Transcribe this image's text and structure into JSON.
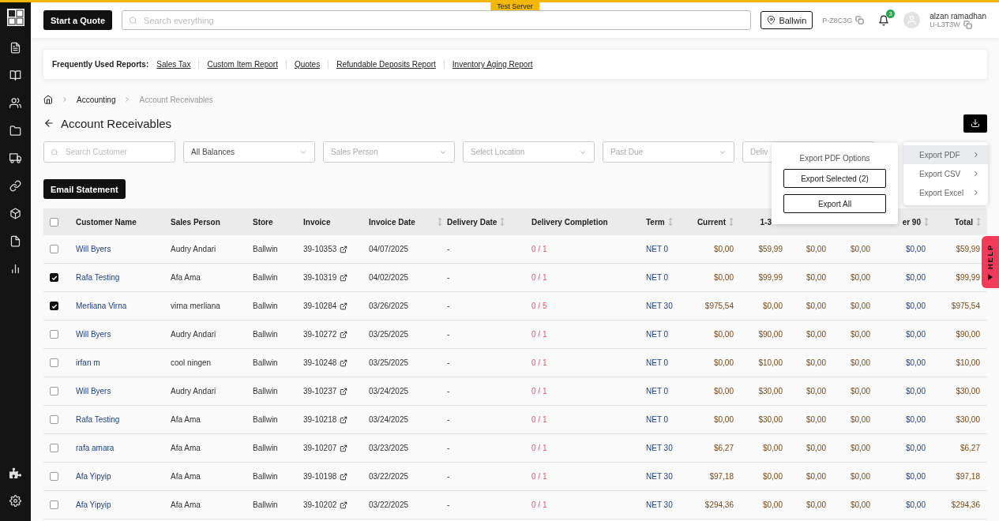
{
  "topbar": {
    "quote_button": "Start a Quote",
    "search": {
      "placeholder": "Search everything"
    },
    "server_badge": "Test Server",
    "location": "Ballwin",
    "profile_code": "P-Z8C3G",
    "notification_count": "3",
    "user": {
      "name": "alzan ramadhan",
      "code": "U-L3T3W"
    }
  },
  "reports": {
    "label": "Frequently Used Reports:",
    "links": [
      "Sales Tax",
      "Custom Item Report",
      "Quotes",
      "Refundable Deposits Report",
      "Inventory Aging Report"
    ]
  },
  "breadcrumb": [
    "Accounting",
    "Account Receivables"
  ],
  "title": "Account Receivables",
  "filters": [
    {
      "kind": "search",
      "placeholder": "Search Customer"
    },
    {
      "kind": "select",
      "value": "All Balances"
    },
    {
      "kind": "select",
      "placeholder": "Sales Person"
    },
    {
      "kind": "select",
      "placeholder": "Select Location"
    },
    {
      "kind": "select",
      "placeholder": "Past Due"
    },
    {
      "kind": "select",
      "placeholder": "Deliv"
    }
  ],
  "email_button": "Email Statement",
  "export_menu": {
    "items": [
      {
        "label": "Export PDF",
        "selected": true
      },
      {
        "label": "Export CSV",
        "selected": false
      },
      {
        "label": "Export Excel",
        "selected": false
      }
    ]
  },
  "export_popup": {
    "title": "Export PDF Options",
    "buttons": [
      "Export Selected (2)",
      "Export All"
    ]
  },
  "help_tab": "HELP",
  "table": {
    "select_all_checked": false,
    "columns": [
      {
        "label": "Customer Name",
        "sortable": false
      },
      {
        "label": "Sales Person",
        "sortable": false
      },
      {
        "label": "Store",
        "sortable": false
      },
      {
        "label": "Invoice",
        "sortable": false
      },
      {
        "label": "Invoice Date",
        "sortable": true
      },
      {
        "label": "Delivery Date",
        "sortable": true
      },
      {
        "label": "Delivery Completion",
        "sortable": false
      },
      {
        "label": "Term",
        "sortable": true
      },
      {
        "label": "Current",
        "sortable": true
      },
      {
        "label": "1-3",
        "sortable": false
      },
      {},
      {},
      {
        "label": "er 90",
        "sortable": true
      },
      {
        "label": "Total",
        "sortable": true
      }
    ],
    "rows": [
      {
        "checked": false,
        "customer": "Will Byers",
        "sales_person": "Audry Andari",
        "store": "Ballwin",
        "invoice": "39-10353",
        "invoice_date": "04/07/2025",
        "delivery_date": "-",
        "completion": "0 / 1",
        "term": "NET 0",
        "amounts": [
          "$0,00",
          "$59,99",
          "$0,00",
          "$0,00",
          "$0,00",
          "$59,99"
        ]
      },
      {
        "checked": true,
        "customer": "Rafa Testing",
        "sales_person": "Afa Ama",
        "store": "Ballwin",
        "invoice": "39-10319",
        "invoice_date": "04/02/2025",
        "delivery_date": "-",
        "completion": "0 / 1",
        "term": "NET 0",
        "amounts": [
          "$0,00",
          "$99,99",
          "$0,00",
          "$0,00",
          "$0,00",
          "$99,99"
        ]
      },
      {
        "checked": true,
        "customer": "Merliana Virna",
        "sales_person": "virna merliana",
        "store": "Ballwin",
        "invoice": "39-10284",
        "invoice_date": "03/26/2025",
        "delivery_date": "-",
        "completion": "0 / 5",
        "term": "NET 30",
        "amounts": [
          "$975,54",
          "$0,00",
          "$0,00",
          "$0,00",
          "$0,00",
          "$975,54"
        ]
      },
      {
        "checked": false,
        "customer": "Will Byers",
        "sales_person": "Audry Andari",
        "store": "Ballwin",
        "invoice": "39-10272",
        "invoice_date": "03/25/2025",
        "delivery_date": "-",
        "completion": "0 / 1",
        "term": "NET 0",
        "amounts": [
          "$0,00",
          "$90,00",
          "$0,00",
          "$0,00",
          "$0,00",
          "$90,00"
        ]
      },
      {
        "checked": false,
        "customer": "irfan m",
        "sales_person": "cool ningen",
        "store": "Ballwin",
        "invoice": "39-10248",
        "invoice_date": "03/25/2025",
        "delivery_date": "-",
        "completion": "0 / 1",
        "term": "NET 0",
        "amounts": [
          "$0,00",
          "$10,00",
          "$0,00",
          "$0,00",
          "$0,00",
          "$10,00"
        ]
      },
      {
        "checked": false,
        "customer": "Will Byers",
        "sales_person": "Audry Andari",
        "store": "Ballwin",
        "invoice": "39-10237",
        "invoice_date": "03/24/2025",
        "delivery_date": "-",
        "completion": "0 / 1",
        "term": "NET 0",
        "amounts": [
          "$0,00",
          "$30,00",
          "$0,00",
          "$0,00",
          "$0,00",
          "$30,00"
        ]
      },
      {
        "checked": false,
        "customer": "Rafa Testing",
        "sales_person": "Afa Ama",
        "store": "Ballwin",
        "invoice": "39-10218",
        "invoice_date": "03/24/2025",
        "delivery_date": "-",
        "completion": "0 / 1",
        "term": "NET 0",
        "amounts": [
          "$0,00",
          "$30,00",
          "$0,00",
          "$0,00",
          "$0,00",
          "$30,00"
        ]
      },
      {
        "checked": false,
        "customer": "rafa amara",
        "sales_person": "Afa Ama",
        "store": "Ballwin",
        "invoice": "39-10207",
        "invoice_date": "03/23/2025",
        "delivery_date": "-",
        "completion": "0 / 1",
        "term": "NET 30",
        "amounts": [
          "$6,27",
          "$0,00",
          "$0,00",
          "$0,00",
          "$0,00",
          "$6,27"
        ]
      },
      {
        "checked": false,
        "customer": "Afa Yipyip",
        "sales_person": "Afa Ama",
        "store": "Ballwin",
        "invoice": "39-10198",
        "invoice_date": "03/22/2025",
        "delivery_date": "-",
        "completion": "0 / 1",
        "term": "NET 30",
        "amounts": [
          "$97,18",
          "$0,00",
          "$0,00",
          "$0,00",
          "$0,00",
          "$97,18"
        ]
      },
      {
        "checked": false,
        "customer": "Afa Yipyip",
        "sales_person": "Afa Ama",
        "store": "Ballwin",
        "invoice": "39-10202",
        "invoice_date": "03/22/2025",
        "delivery_date": "-",
        "completion": "0 / 1",
        "term": "NET 30",
        "amounts": [
          "$294,36",
          "$0,00",
          "$0,00",
          "$0,00",
          "$0,00",
          "$294,36"
        ]
      }
    ]
  }
}
